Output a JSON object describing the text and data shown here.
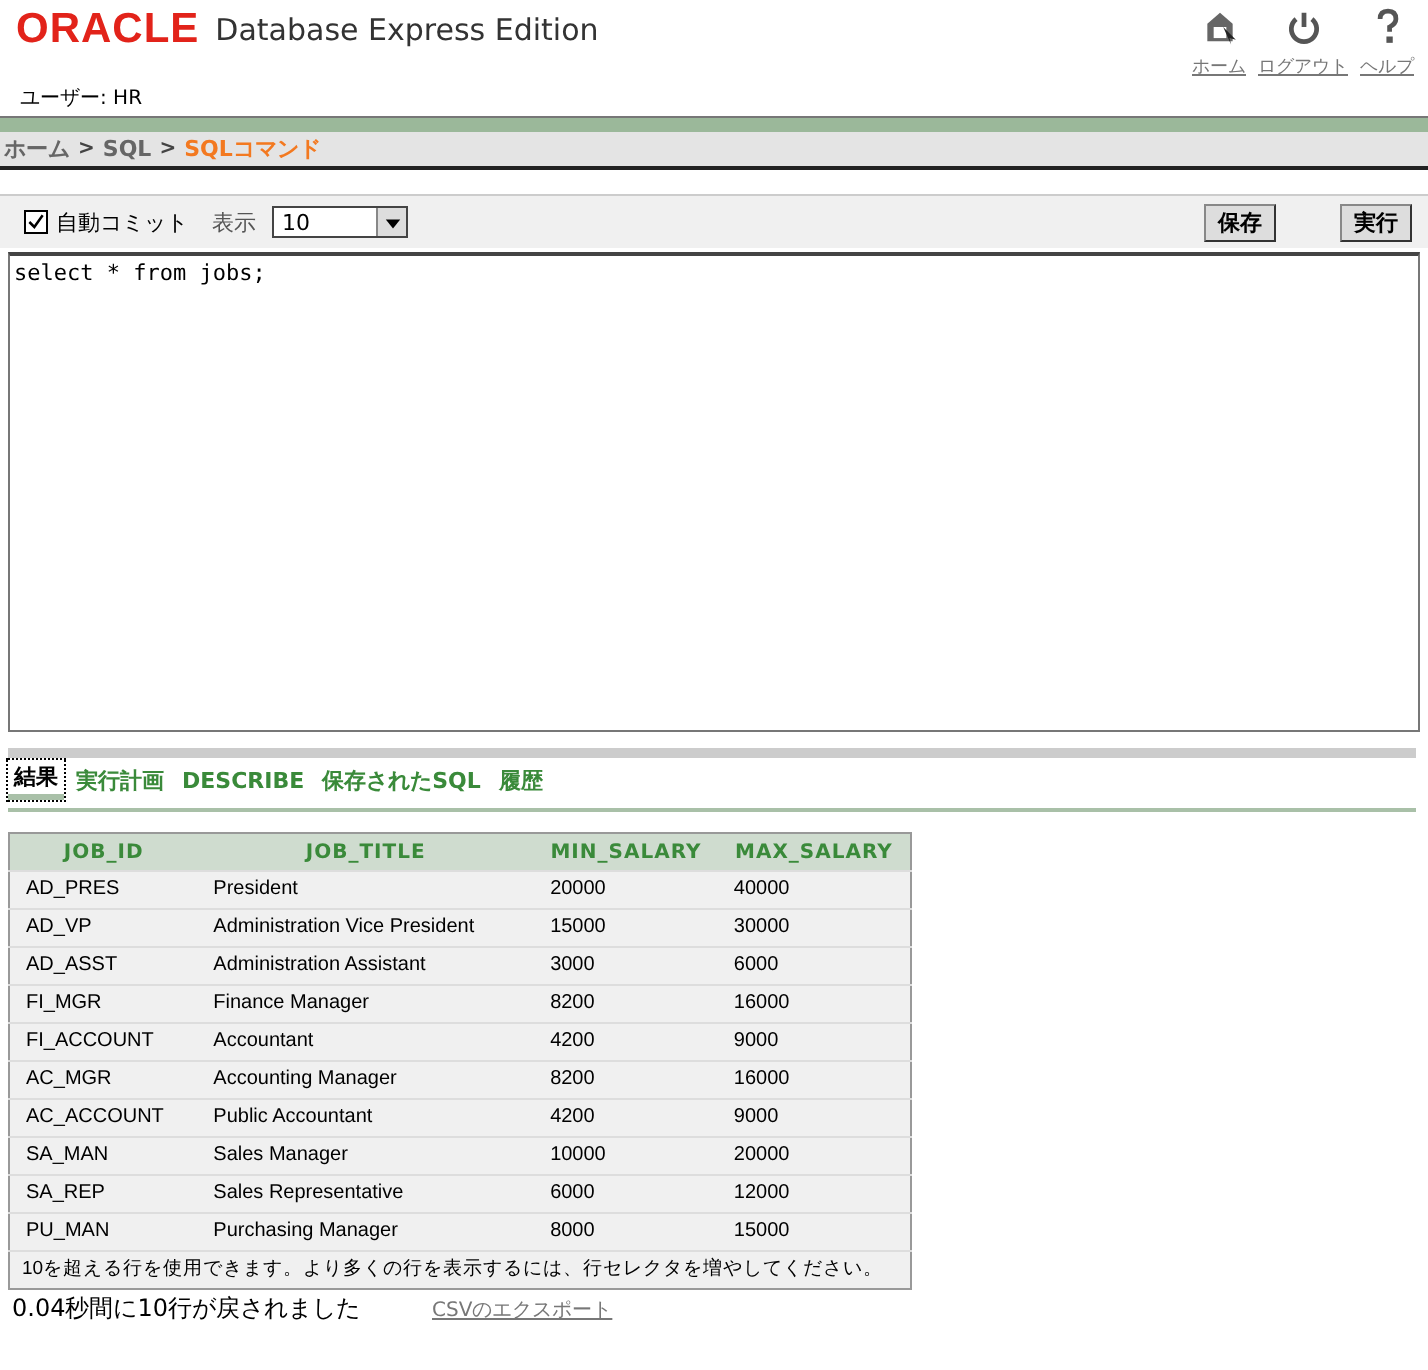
{
  "header": {
    "logo": "ORACLE",
    "product": "Database Express Edition",
    "user": "ユーザー: HR",
    "links": [
      {
        "kind": "home",
        "label": "ホーム"
      },
      {
        "kind": "logout",
        "label": "ログアウト"
      },
      {
        "kind": "help",
        "label": "ヘルプ"
      }
    ]
  },
  "breadcrumb": [
    {
      "label": "ホーム",
      "current": false
    },
    {
      "label": "SQL",
      "current": false
    },
    {
      "label": "SQLコマンド",
      "current": true
    }
  ],
  "breadcrumb_separator": ">",
  "toolbar": {
    "autocommit": {
      "label": "自動コミット",
      "checked": true
    },
    "display_label": "表示",
    "display_value": "10",
    "buttons": [
      "保存",
      "実行"
    ]
  },
  "editor": {
    "value": "select * from jobs;"
  },
  "tabs": [
    {
      "label": "結果",
      "selected": true
    },
    {
      "label": "実行計画",
      "selected": false
    },
    {
      "label": "DESCRIBE",
      "selected": false
    },
    {
      "label": "保存されたSQL",
      "selected": false
    },
    {
      "label": "履歴",
      "selected": false
    }
  ],
  "table": {
    "columns": [
      "JOB_ID",
      "JOB_TITLE",
      "MIN_SALARY",
      "MAX_SALARY"
    ],
    "rows": [
      [
        "AD_PRES",
        "President",
        "20000",
        "40000"
      ],
      [
        "AD_VP",
        "Administration Vice President",
        "15000",
        "30000"
      ],
      [
        "AD_ASST",
        "Administration Assistant",
        "3000",
        "6000"
      ],
      [
        "FI_MGR",
        "Finance Manager",
        "8200",
        "16000"
      ],
      [
        "FI_ACCOUNT",
        "Accountant",
        "4200",
        "9000"
      ],
      [
        "AC_MGR",
        "Accounting Manager",
        "8200",
        "16000"
      ],
      [
        "AC_ACCOUNT",
        "Public Accountant",
        "4200",
        "9000"
      ],
      [
        "SA_MAN",
        "Sales Manager",
        "10000",
        "20000"
      ],
      [
        "SA_REP",
        "Sales Representative",
        "6000",
        "12000"
      ],
      [
        "PU_MAN",
        "Purchasing Manager",
        "8000",
        "15000"
      ]
    ],
    "note": "10を超える行を使用できます。より多くの行を表示するには、行セレクタを増やしてください。"
  },
  "status": {
    "message": "0.04秒間に10行が戻されました",
    "export_link": "CSVのエクスポート"
  }
}
